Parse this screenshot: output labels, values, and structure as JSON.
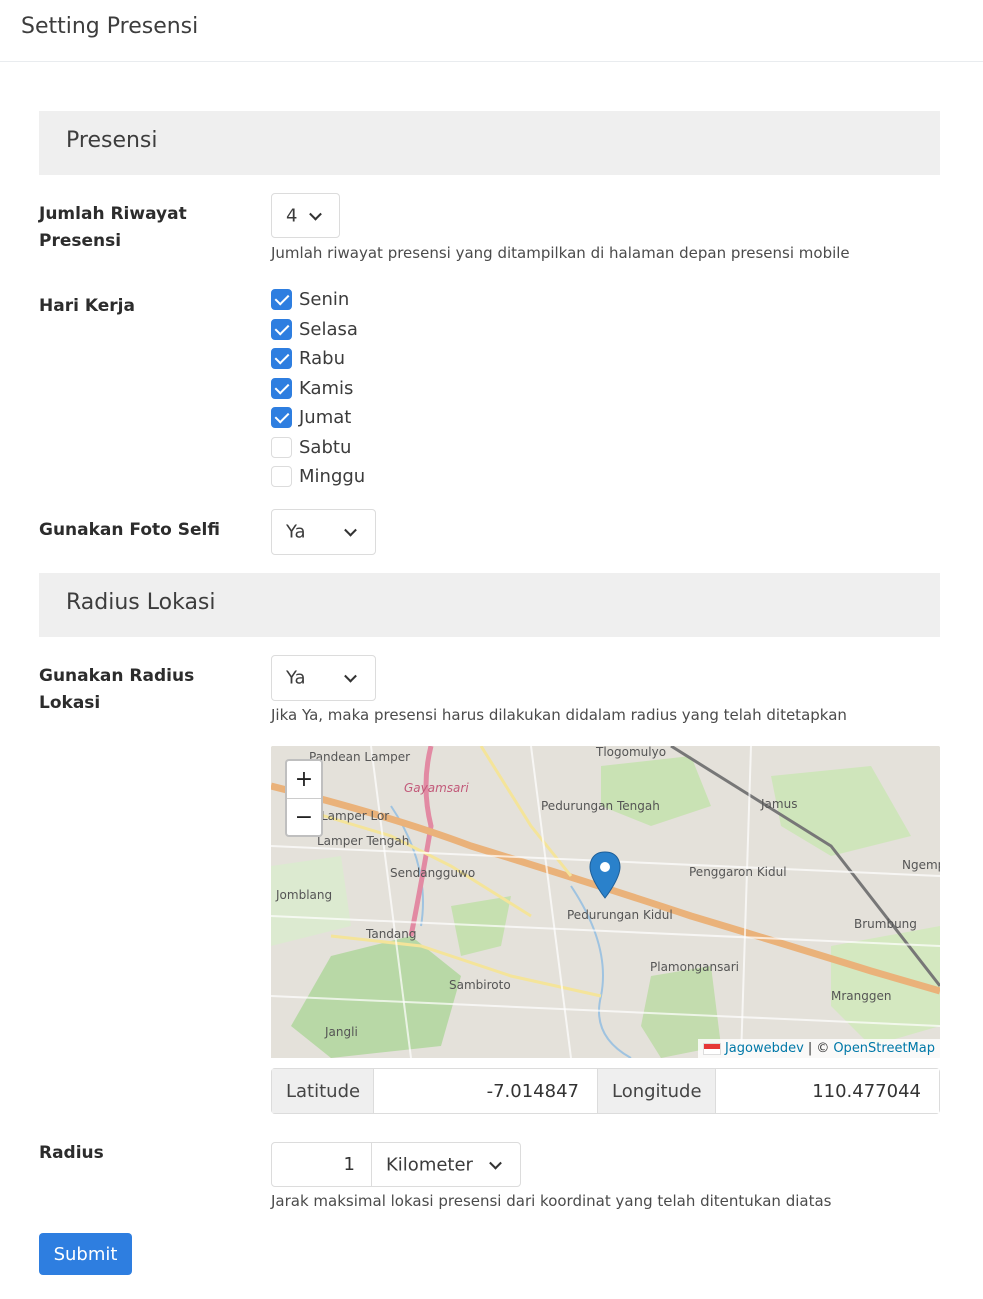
{
  "header": {
    "title": "Setting Presensi"
  },
  "sections": {
    "presensi": "Presensi",
    "radius": "Radius Lokasi"
  },
  "jumlah_riwayat": {
    "label": "Jumlah Riwayat Presensi",
    "value": "4",
    "help": "Jumlah riwayat presensi yang ditampilkan di halaman depan presensi mobile"
  },
  "hari_kerja": {
    "label": "Hari Kerja",
    "days": [
      {
        "label": "Senin",
        "checked": true
      },
      {
        "label": "Selasa",
        "checked": true
      },
      {
        "label": "Rabu",
        "checked": true
      },
      {
        "label": "Kamis",
        "checked": true
      },
      {
        "label": "Jumat",
        "checked": true
      },
      {
        "label": "Sabtu",
        "checked": false
      },
      {
        "label": "Minggu",
        "checked": false
      }
    ]
  },
  "foto_selfi": {
    "label": "Gunakan Foto Selfi",
    "value": "Ya"
  },
  "radius_lokasi": {
    "label": "Gunakan Radius Lokasi",
    "value": "Ya",
    "help": "Jika Ya, maka presensi harus dilakukan didalam radius yang telah ditetapkan"
  },
  "map": {
    "zoom_in": "+",
    "zoom_out": "−",
    "attribution_a": "Jagowebdev",
    "attribution_sep": " | © ",
    "attribution_b": "OpenStreetMap",
    "places": [
      "Pandean Lamper",
      "Gayamsari",
      "Tlogomulyo",
      "Pedurungan Tengah",
      "Jamus",
      "Lamper Lor",
      "Lamper Tengah",
      "Sendangguwo",
      "Penggaron Kidul",
      "Ngemplak",
      "Jomblang",
      "Pedurungan Kidul",
      "Brumbung",
      "Tandang",
      "Plamongansari",
      "Sambiroto",
      "Mranggen",
      "Jangli"
    ]
  },
  "coords": {
    "lat_label": "Latitude",
    "lat_value": "-7.014847",
    "lng_label": "Longitude",
    "lng_value": "110.477044"
  },
  "radius": {
    "label": "Radius",
    "value": "1",
    "unit": "Kilometer",
    "help": "Jarak maksimal lokasi presensi dari koordinat yang telah ditentukan diatas"
  },
  "submit_label": "Submit"
}
